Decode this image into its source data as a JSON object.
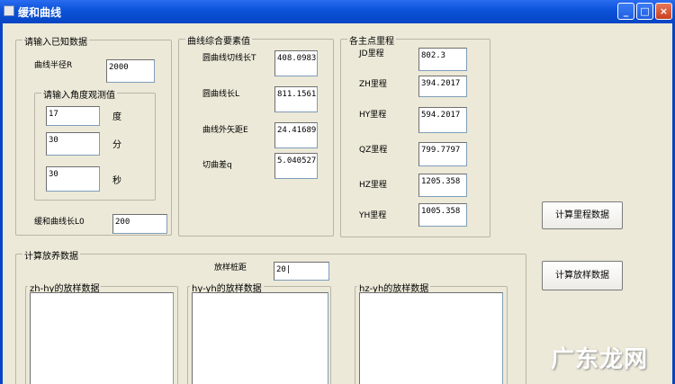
{
  "window": {
    "title": "缓和曲线",
    "min_glyph": "_",
    "max_glyph": "□",
    "close_glyph": "×"
  },
  "known": {
    "title": "请输入已知数据",
    "radius_label": "曲线半径R",
    "radius_value": "2000",
    "angle_group_title": "请输入角度观测值",
    "degree_value": "17",
    "degree_label": "度",
    "minute_value": "30",
    "minute_label": "分",
    "second_value": "30",
    "second_label": "秒",
    "transition_label": "缓和曲线长L0",
    "transition_value": "200"
  },
  "elements": {
    "title": "曲线综合要素值",
    "tangent_label": "圆曲线切线长T",
    "tangent_value": "408.0983",
    "length_label": "圆曲线长L",
    "length_value": "811.1561",
    "external_label": "曲线外矢距E",
    "external_value": "24.41689",
    "diff_label": "切曲差q",
    "diff_value": "5.040527"
  },
  "stations": {
    "title": "各主点里程",
    "jd_label": "JD里程",
    "jd_value": "802.3",
    "zh_label": "ZH里程",
    "zh_value": "394.2017",
    "hy_label": "HY里程",
    "hy_value": "594.2017",
    "qz_label": "QZ里程",
    "qz_value": "799.7797",
    "hz_label": "HZ里程",
    "hz_value": "1205.358",
    "yh_label": "YH里程",
    "yh_value": "1005.358"
  },
  "buttons": {
    "calc_stations": "计算里程数据",
    "calc_layout": "计算放样数据"
  },
  "layout": {
    "title": "计算放养数据",
    "spacing_label": "放样桩距",
    "spacing_value": "20|",
    "zh_hy_title": "zh-hy的放样数据",
    "hy_yh_title": "hy-yh的放样数据",
    "hz_yh_title": "hz-yh的放样数据"
  },
  "watermark": "广东龙网"
}
